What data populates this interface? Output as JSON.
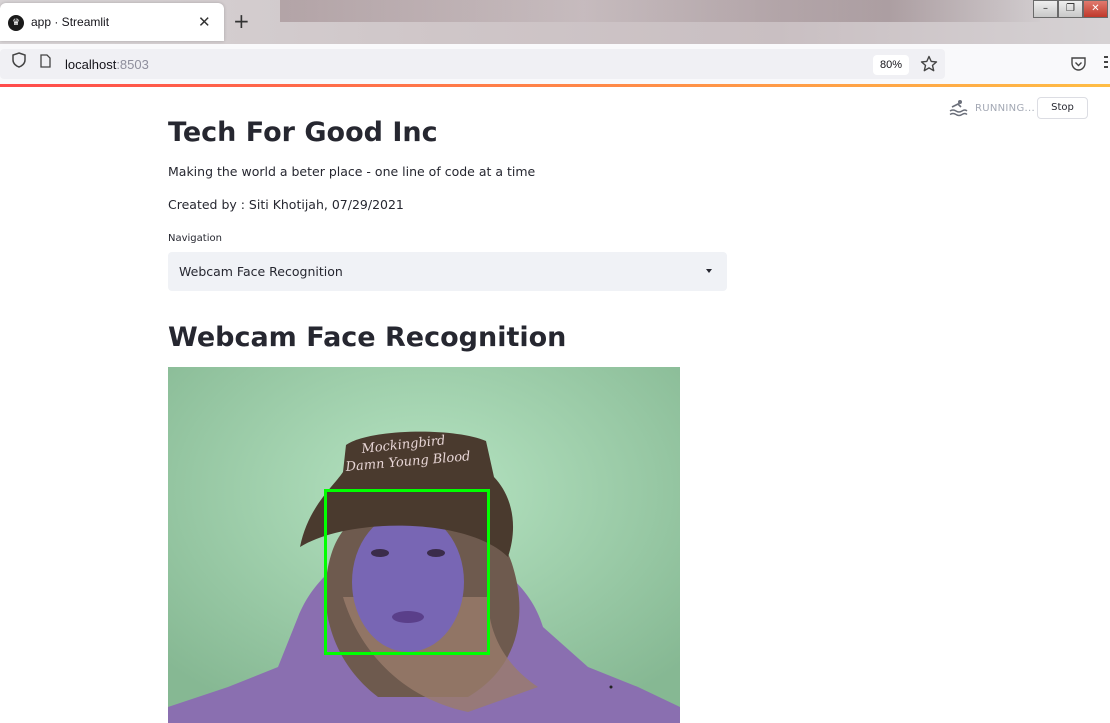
{
  "browser": {
    "tab_title": "app · Streamlit",
    "tab_close": "✕",
    "new_tab": "+",
    "url_host": "localhost",
    "url_port": ":8503",
    "zoom": "80%"
  },
  "status": {
    "running_label": "RUNNING...",
    "stop_label": "Stop"
  },
  "app": {
    "title": "Tech For Good Inc",
    "subtitle": "Making the world a beter place - one line of code at a time",
    "creator": "Created by : Siti Khotijah, 07/29/2021",
    "nav_label": "Navigation",
    "nav_selected": "Webcam Face Recognition",
    "section_title": "Webcam Face Recognition"
  },
  "webcam": {
    "hat_text_line1": "Mockingbird",
    "hat_text_line2": "Damn Young Blood"
  },
  "colors": {
    "accent_start": "#ff4b4b",
    "accent_end": "#ffbd45",
    "detection_box": "#00ff00",
    "select_bg": "#f0f2f6"
  }
}
